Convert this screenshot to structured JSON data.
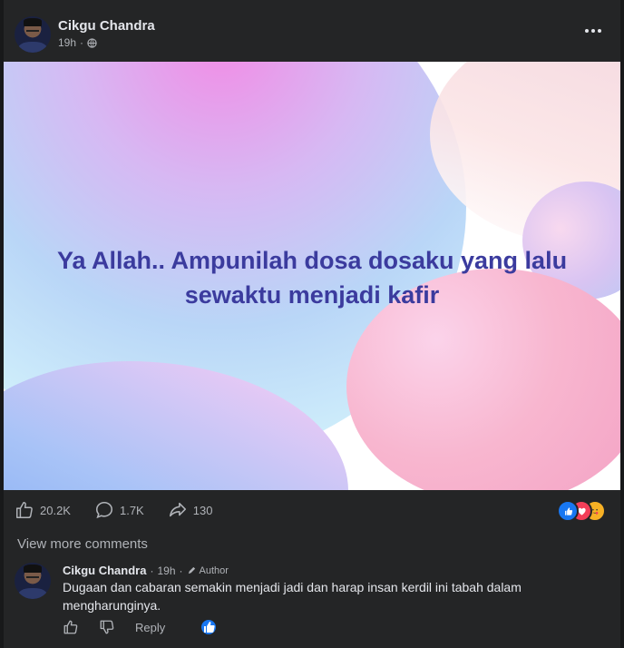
{
  "post": {
    "author_name": "Cikgu Chandra",
    "time": "19h",
    "separator": "·",
    "privacy_icon": "globe-icon",
    "more_icon": "more-options-icon",
    "content_text_line1": "Ya Allah.. Ampunilah dosa dosaku yang lalu",
    "content_text_line2": "sewaktu menjadi kafir",
    "colors": {
      "text": "#3b3b9e",
      "background": "#242526",
      "accent": "#1877f2"
    }
  },
  "stats": {
    "likes": "20.2K",
    "comments": "1.7K",
    "shares": "130",
    "reaction_icons": [
      "like-reaction-icon",
      "love-reaction-icon",
      "care-reaction-icon"
    ]
  },
  "comments_section": {
    "view_more": "View more comments",
    "comment": {
      "author_name": "Cikgu Chandra",
      "time": "19h",
      "separator": "·",
      "badge": "Author",
      "text": "Dugaan dan cabaran semakin menjadi jadi dan harap insan kerdil ini tabah dalam mengharunginya.",
      "reply_label": "Reply"
    }
  }
}
